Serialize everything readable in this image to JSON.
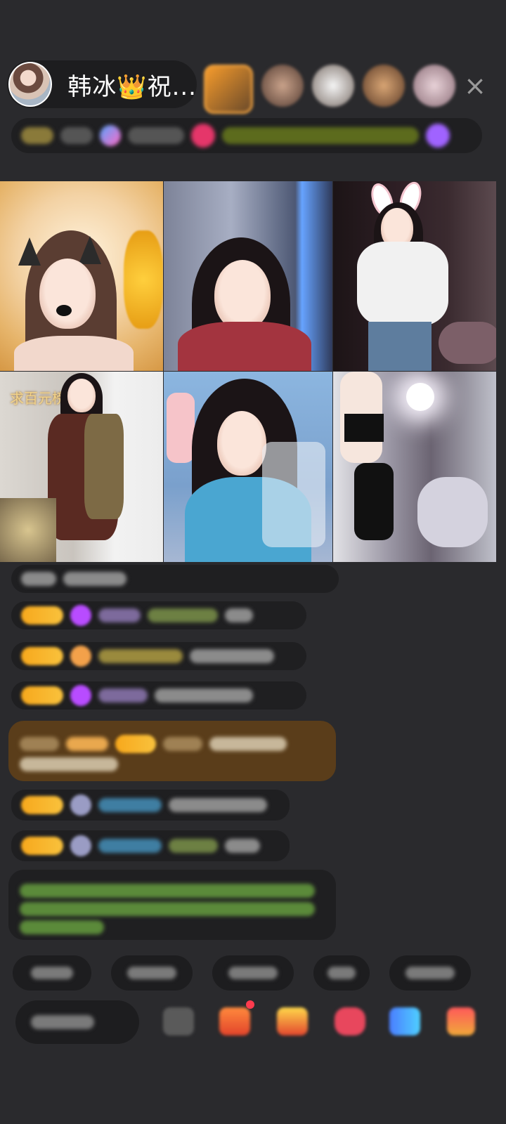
{
  "header": {
    "host_name": "韩冰👑祝...",
    "close_icon": "×"
  },
  "grid": {
    "tile_label": "求百元榜"
  },
  "colors": {
    "background": "#2a2a2d",
    "pill": "#1d1d1f",
    "level_badge": "#f7a81c",
    "notice_gold": "#5a3d1a",
    "notice_green_text": "#7cc35a"
  }
}
